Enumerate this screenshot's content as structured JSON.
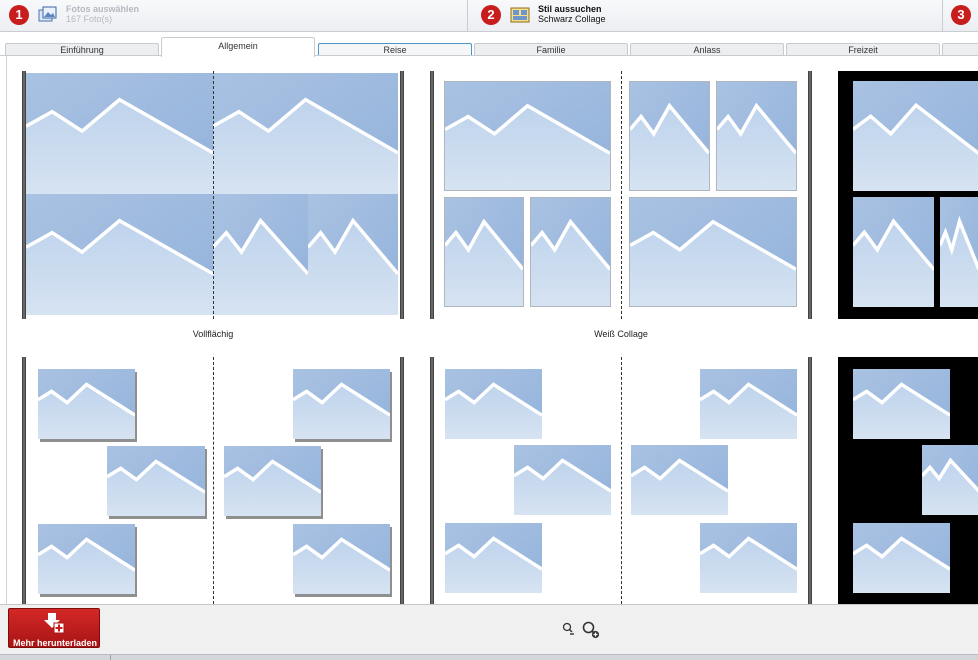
{
  "wizard": {
    "steps": [
      {
        "number": "1",
        "title": "Fotos auswählen",
        "subtitle": "167 Foto(s)"
      },
      {
        "number": "2",
        "title": "Stil aussuchen",
        "subtitle": "Schwarz Collage"
      },
      {
        "number": "3"
      }
    ]
  },
  "tabs": [
    "Einführung",
    "Allgemein",
    "Reise",
    "Familie",
    "Anlass",
    "Freizeit"
  ],
  "active_tab": "Allgemein",
  "gallery": {
    "styles": [
      "Vollflächig",
      "Weiß Collage"
    ]
  },
  "bottom": {
    "download_label": "Mehr herunterladen"
  },
  "colors": {
    "accent": "#c81d1d",
    "tab_hover_border": "#4f95c6",
    "photo_placeholder": "#a9c2e2"
  },
  "icons": [
    "photos-icon",
    "style-icon",
    "download-icon",
    "zoom-out-icon",
    "zoom-in-icon"
  ]
}
